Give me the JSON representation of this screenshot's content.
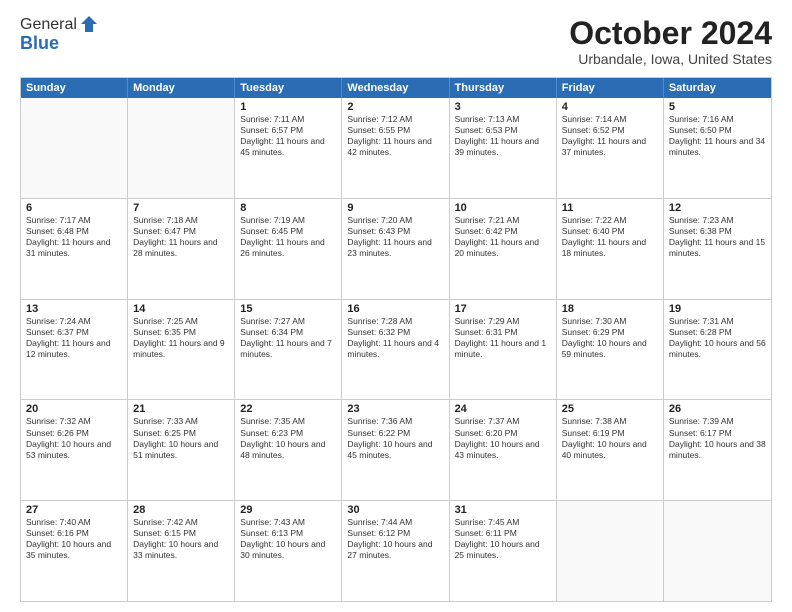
{
  "header": {
    "logo_general": "General",
    "logo_blue": "Blue",
    "month_title": "October 2024",
    "location": "Urbandale, Iowa, United States"
  },
  "weekdays": [
    "Sunday",
    "Monday",
    "Tuesday",
    "Wednesday",
    "Thursday",
    "Friday",
    "Saturday"
  ],
  "rows": [
    [
      {
        "day": "",
        "empty": true
      },
      {
        "day": "",
        "empty": true
      },
      {
        "day": "1",
        "sunrise": "Sunrise: 7:11 AM",
        "sunset": "Sunset: 6:57 PM",
        "daylight": "Daylight: 11 hours and 45 minutes."
      },
      {
        "day": "2",
        "sunrise": "Sunrise: 7:12 AM",
        "sunset": "Sunset: 6:55 PM",
        "daylight": "Daylight: 11 hours and 42 minutes."
      },
      {
        "day": "3",
        "sunrise": "Sunrise: 7:13 AM",
        "sunset": "Sunset: 6:53 PM",
        "daylight": "Daylight: 11 hours and 39 minutes."
      },
      {
        "day": "4",
        "sunrise": "Sunrise: 7:14 AM",
        "sunset": "Sunset: 6:52 PM",
        "daylight": "Daylight: 11 hours and 37 minutes."
      },
      {
        "day": "5",
        "sunrise": "Sunrise: 7:16 AM",
        "sunset": "Sunset: 6:50 PM",
        "daylight": "Daylight: 11 hours and 34 minutes."
      }
    ],
    [
      {
        "day": "6",
        "sunrise": "Sunrise: 7:17 AM",
        "sunset": "Sunset: 6:48 PM",
        "daylight": "Daylight: 11 hours and 31 minutes."
      },
      {
        "day": "7",
        "sunrise": "Sunrise: 7:18 AM",
        "sunset": "Sunset: 6:47 PM",
        "daylight": "Daylight: 11 hours and 28 minutes."
      },
      {
        "day": "8",
        "sunrise": "Sunrise: 7:19 AM",
        "sunset": "Sunset: 6:45 PM",
        "daylight": "Daylight: 11 hours and 26 minutes."
      },
      {
        "day": "9",
        "sunrise": "Sunrise: 7:20 AM",
        "sunset": "Sunset: 6:43 PM",
        "daylight": "Daylight: 11 hours and 23 minutes."
      },
      {
        "day": "10",
        "sunrise": "Sunrise: 7:21 AM",
        "sunset": "Sunset: 6:42 PM",
        "daylight": "Daylight: 11 hours and 20 minutes."
      },
      {
        "day": "11",
        "sunrise": "Sunrise: 7:22 AM",
        "sunset": "Sunset: 6:40 PM",
        "daylight": "Daylight: 11 hours and 18 minutes."
      },
      {
        "day": "12",
        "sunrise": "Sunrise: 7:23 AM",
        "sunset": "Sunset: 6:38 PM",
        "daylight": "Daylight: 11 hours and 15 minutes."
      }
    ],
    [
      {
        "day": "13",
        "sunrise": "Sunrise: 7:24 AM",
        "sunset": "Sunset: 6:37 PM",
        "daylight": "Daylight: 11 hours and 12 minutes."
      },
      {
        "day": "14",
        "sunrise": "Sunrise: 7:25 AM",
        "sunset": "Sunset: 6:35 PM",
        "daylight": "Daylight: 11 hours and 9 minutes."
      },
      {
        "day": "15",
        "sunrise": "Sunrise: 7:27 AM",
        "sunset": "Sunset: 6:34 PM",
        "daylight": "Daylight: 11 hours and 7 minutes."
      },
      {
        "day": "16",
        "sunrise": "Sunrise: 7:28 AM",
        "sunset": "Sunset: 6:32 PM",
        "daylight": "Daylight: 11 hours and 4 minutes."
      },
      {
        "day": "17",
        "sunrise": "Sunrise: 7:29 AM",
        "sunset": "Sunset: 6:31 PM",
        "daylight": "Daylight: 11 hours and 1 minute."
      },
      {
        "day": "18",
        "sunrise": "Sunrise: 7:30 AM",
        "sunset": "Sunset: 6:29 PM",
        "daylight": "Daylight: 10 hours and 59 minutes."
      },
      {
        "day": "19",
        "sunrise": "Sunrise: 7:31 AM",
        "sunset": "Sunset: 6:28 PM",
        "daylight": "Daylight: 10 hours and 56 minutes."
      }
    ],
    [
      {
        "day": "20",
        "sunrise": "Sunrise: 7:32 AM",
        "sunset": "Sunset: 6:26 PM",
        "daylight": "Daylight: 10 hours and 53 minutes."
      },
      {
        "day": "21",
        "sunrise": "Sunrise: 7:33 AM",
        "sunset": "Sunset: 6:25 PM",
        "daylight": "Daylight: 10 hours and 51 minutes."
      },
      {
        "day": "22",
        "sunrise": "Sunrise: 7:35 AM",
        "sunset": "Sunset: 6:23 PM",
        "daylight": "Daylight: 10 hours and 48 minutes."
      },
      {
        "day": "23",
        "sunrise": "Sunrise: 7:36 AM",
        "sunset": "Sunset: 6:22 PM",
        "daylight": "Daylight: 10 hours and 45 minutes."
      },
      {
        "day": "24",
        "sunrise": "Sunrise: 7:37 AM",
        "sunset": "Sunset: 6:20 PM",
        "daylight": "Daylight: 10 hours and 43 minutes."
      },
      {
        "day": "25",
        "sunrise": "Sunrise: 7:38 AM",
        "sunset": "Sunset: 6:19 PM",
        "daylight": "Daylight: 10 hours and 40 minutes."
      },
      {
        "day": "26",
        "sunrise": "Sunrise: 7:39 AM",
        "sunset": "Sunset: 6:17 PM",
        "daylight": "Daylight: 10 hours and 38 minutes."
      }
    ],
    [
      {
        "day": "27",
        "sunrise": "Sunrise: 7:40 AM",
        "sunset": "Sunset: 6:16 PM",
        "daylight": "Daylight: 10 hours and 35 minutes."
      },
      {
        "day": "28",
        "sunrise": "Sunrise: 7:42 AM",
        "sunset": "Sunset: 6:15 PM",
        "daylight": "Daylight: 10 hours and 33 minutes."
      },
      {
        "day": "29",
        "sunrise": "Sunrise: 7:43 AM",
        "sunset": "Sunset: 6:13 PM",
        "daylight": "Daylight: 10 hours and 30 minutes."
      },
      {
        "day": "30",
        "sunrise": "Sunrise: 7:44 AM",
        "sunset": "Sunset: 6:12 PM",
        "daylight": "Daylight: 10 hours and 27 minutes."
      },
      {
        "day": "31",
        "sunrise": "Sunrise: 7:45 AM",
        "sunset": "Sunset: 6:11 PM",
        "daylight": "Daylight: 10 hours and 25 minutes."
      },
      {
        "day": "",
        "empty": true
      },
      {
        "day": "",
        "empty": true
      }
    ]
  ]
}
